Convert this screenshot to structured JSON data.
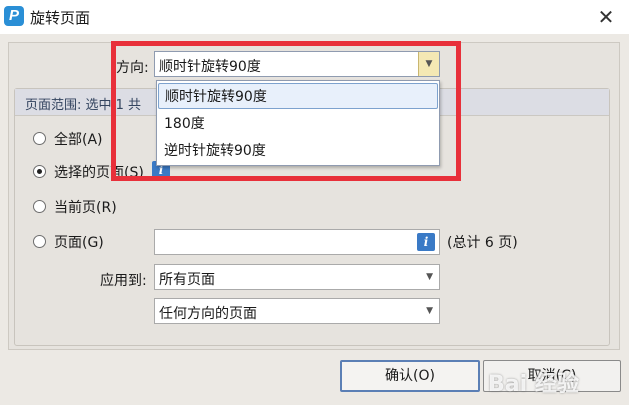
{
  "window": {
    "title": "旋转页面",
    "app_icon_glyph": "P",
    "close_glyph": "✕"
  },
  "direction": {
    "label": "方向:",
    "selected": "顺时针旋转90度",
    "options": [
      "顺时针旋转90度",
      "180度",
      "逆时针旋转90度"
    ]
  },
  "range": {
    "header": "页面范围: 选中 1 共",
    "all_label": "全部(A)",
    "selected_pages_label": "选择的页面(S)",
    "current_page_label": "当前页(R)",
    "pages_label": "页面(G)",
    "pages_value": "",
    "info_glyph": "i",
    "total_text": "(总计 6 页)",
    "checked_option": "selected_pages"
  },
  "apply": {
    "label": "应用到:",
    "pages_scope": "所有页面",
    "orientation_scope": "任何方向的页面"
  },
  "buttons": {
    "ok": "确认(O)",
    "cancel": "取消(C)"
  },
  "watermark": "Bai 经验",
  "colors": {
    "highlight": "#e8303a",
    "accent": "#3a7ac6",
    "arrow_bg": "#f4e8b4"
  }
}
